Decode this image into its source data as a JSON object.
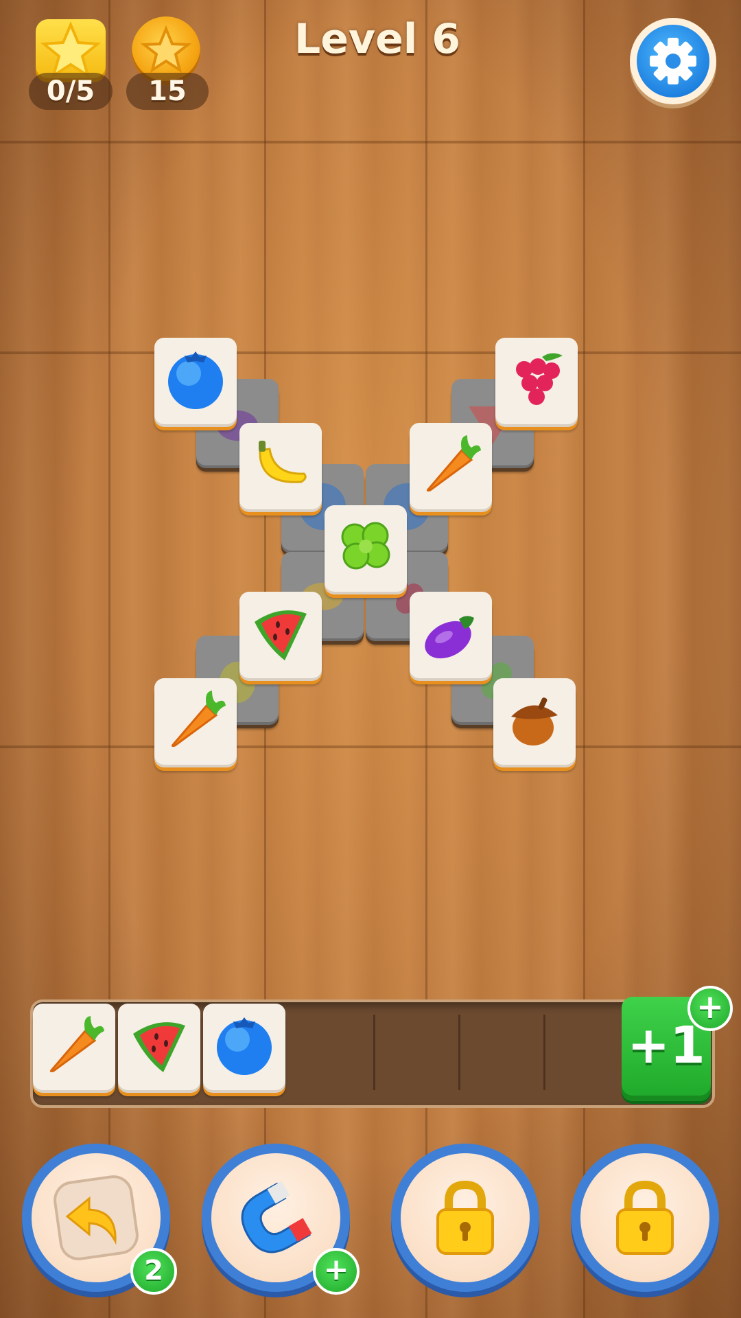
{
  "hud": {
    "stars_progress": "0/5",
    "coins": "15",
    "level_title": "Level 6",
    "settings_icon": "gear-icon"
  },
  "board": {
    "top_tiles": [
      "blueberry",
      "grapes",
      "banana",
      "carrot",
      "clover",
      "watermelon",
      "eggplant",
      "carrot",
      "acorn"
    ],
    "covered_tiles": [
      "eggplant",
      "watermelon",
      "blueberry",
      "blueberry",
      "banana",
      "grapes",
      "pear",
      "clover"
    ]
  },
  "tray": {
    "slots": 7,
    "filled": [
      "carrot",
      "watermelon",
      "blueberry"
    ],
    "extra_slot_label": "+1"
  },
  "boosters": {
    "undo_count": "2",
    "magnet_badge": "+",
    "locked_3": "lock-icon",
    "locked_4": "lock-icon"
  },
  "colors": {
    "accent_green": "#1fa82a",
    "booster_ring": "#3f7fd6",
    "tile_face": "#f5efe6"
  }
}
